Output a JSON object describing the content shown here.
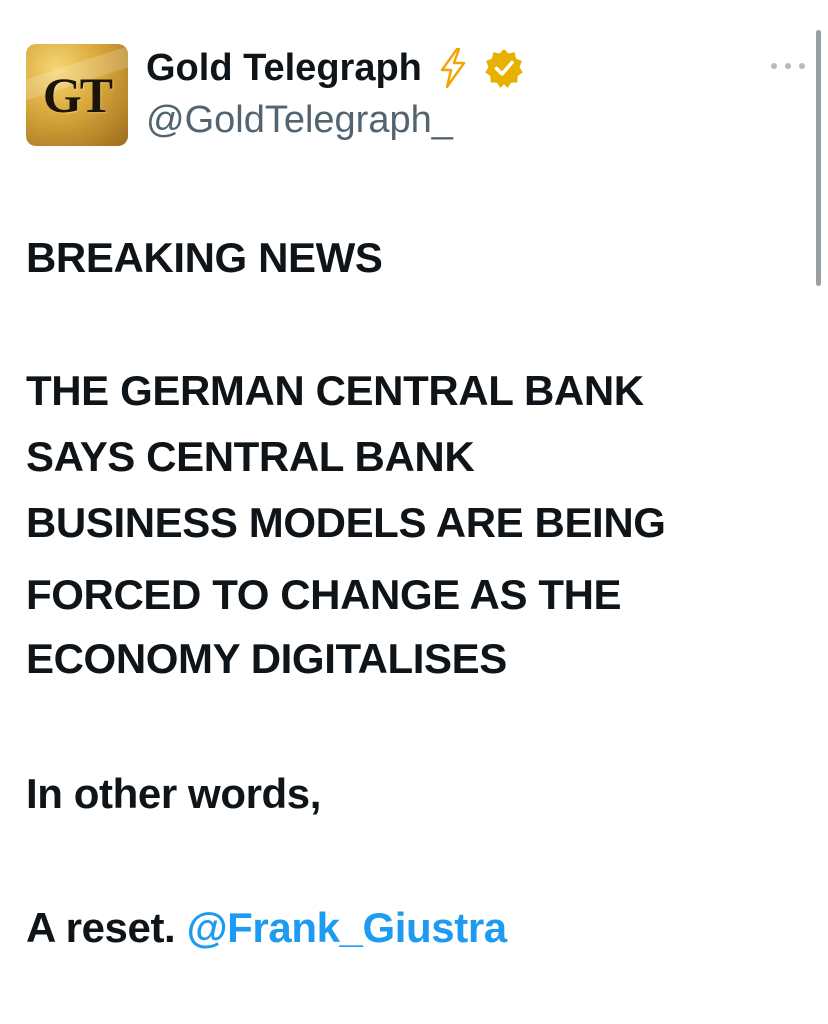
{
  "tweet": {
    "display_name": "Gold Telegraph",
    "handle": "@GoldTelegraph_",
    "avatar_text": "GT",
    "icons": {
      "lightning": "lightning-bolt-emoji",
      "verified": "gold-verified-badge",
      "more": "more-options-ellipsis"
    },
    "lines": [
      "BREAKING NEWS",
      "THE GERMAN CENTRAL BANK",
      "SAYS CENTRAL BANK",
      "BUSINESS MODELS ARE BEING",
      "FORCED TO CHANGE AS THE",
      "ECONOMY DIGITALISES",
      "In other words,",
      "A reset."
    ],
    "mention": "@Frank_Giustra"
  },
  "colors": {
    "text": "#0f1419",
    "secondary": "#536471",
    "link": "#1d9bf0",
    "verified_gold": "#e8b100",
    "bolt": "#f4a300"
  }
}
